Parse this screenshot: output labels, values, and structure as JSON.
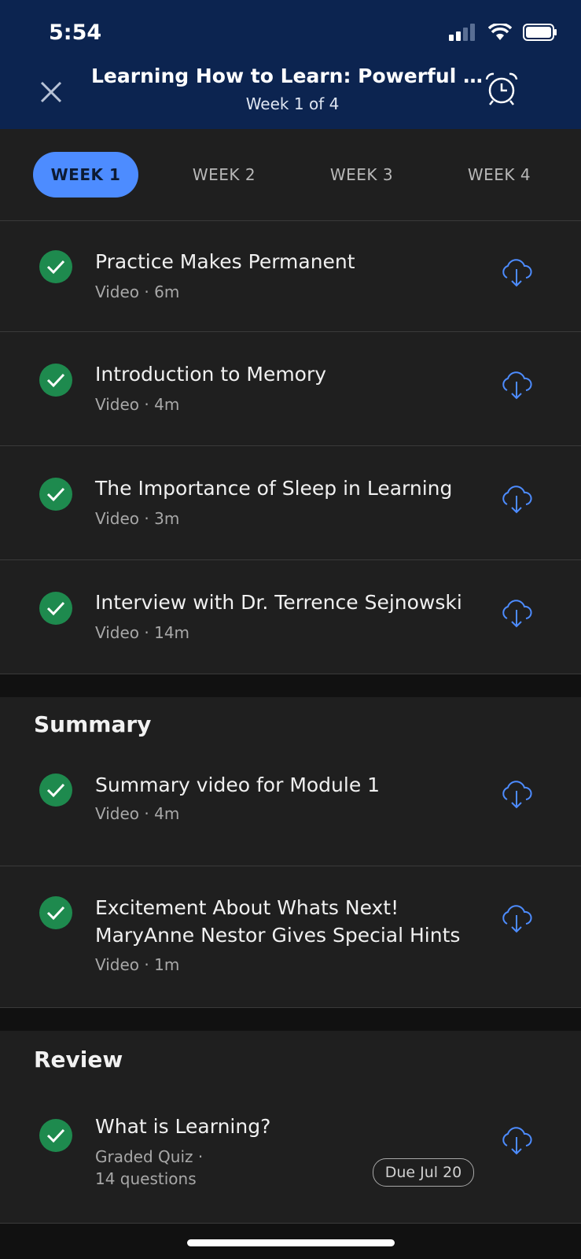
{
  "status": {
    "time": "5:54"
  },
  "header": {
    "title": "Learning How to Learn: Powerful me...",
    "subtitle": "Week 1 of 4"
  },
  "tabs": [
    {
      "label": "WEEK 1",
      "active": true
    },
    {
      "label": "WEEK 2",
      "active": false
    },
    {
      "label": "WEEK 3",
      "active": false
    },
    {
      "label": "WEEK 4",
      "active": false
    }
  ],
  "lessons": [
    {
      "title": "Practice Makes Permanent",
      "meta": "Video · 6m",
      "completed": true
    },
    {
      "title": "Introduction to Memory",
      "meta": "Video · 4m",
      "completed": true
    },
    {
      "title": "The Importance of Sleep in Learning",
      "meta": "Video · 3m",
      "completed": true
    },
    {
      "title": "Interview with Dr. Terrence Sejnowski",
      "meta": "Video · 14m",
      "completed": true
    }
  ],
  "summary": {
    "heading": "Summary",
    "items": [
      {
        "title": "Summary video for Module 1",
        "meta": "Video · 4m",
        "completed": true
      },
      {
        "title_line1": "Excitement About Whats Next!",
        "title_line2": "MaryAnne Nestor Gives Special Hints",
        "meta": "Video · 1m",
        "completed": true
      }
    ]
  },
  "review": {
    "heading": "Review",
    "items": [
      {
        "title": "What is Learning?",
        "meta_line1": "Graded Quiz ·",
        "meta_line2": "14 questions",
        "due": "Due Jul 20",
        "completed": true
      }
    ]
  },
  "colors": {
    "accent": "#4d8cff",
    "header_bg": "#0c2450",
    "check": "#1e8a4e",
    "surface": "#1f1f1f"
  }
}
